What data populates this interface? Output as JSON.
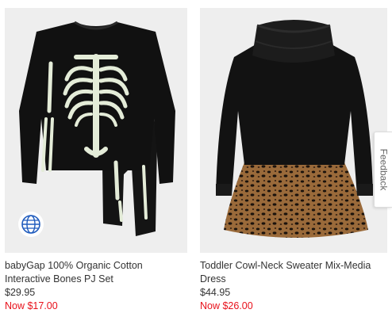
{
  "products": [
    {
      "title_line1": "babyGap 100% Organic Cotton",
      "title_line2": "Interactive Bones PJ Set",
      "price": "$29.95",
      "sale_price": "Now $17.00",
      "badge_icon": "globe-icon"
    },
    {
      "title_line1": "Toddler Cowl-Neck Sweater Mix-Media",
      "title_line2": "Dress",
      "price": "$44.95",
      "sale_price": "Now $26.00"
    }
  ],
  "feedback_label": "Feedback",
  "colors": {
    "sale": "#e8101a",
    "image_bg": "#eeeeee",
    "badge_blue": "#1f5bbd"
  }
}
